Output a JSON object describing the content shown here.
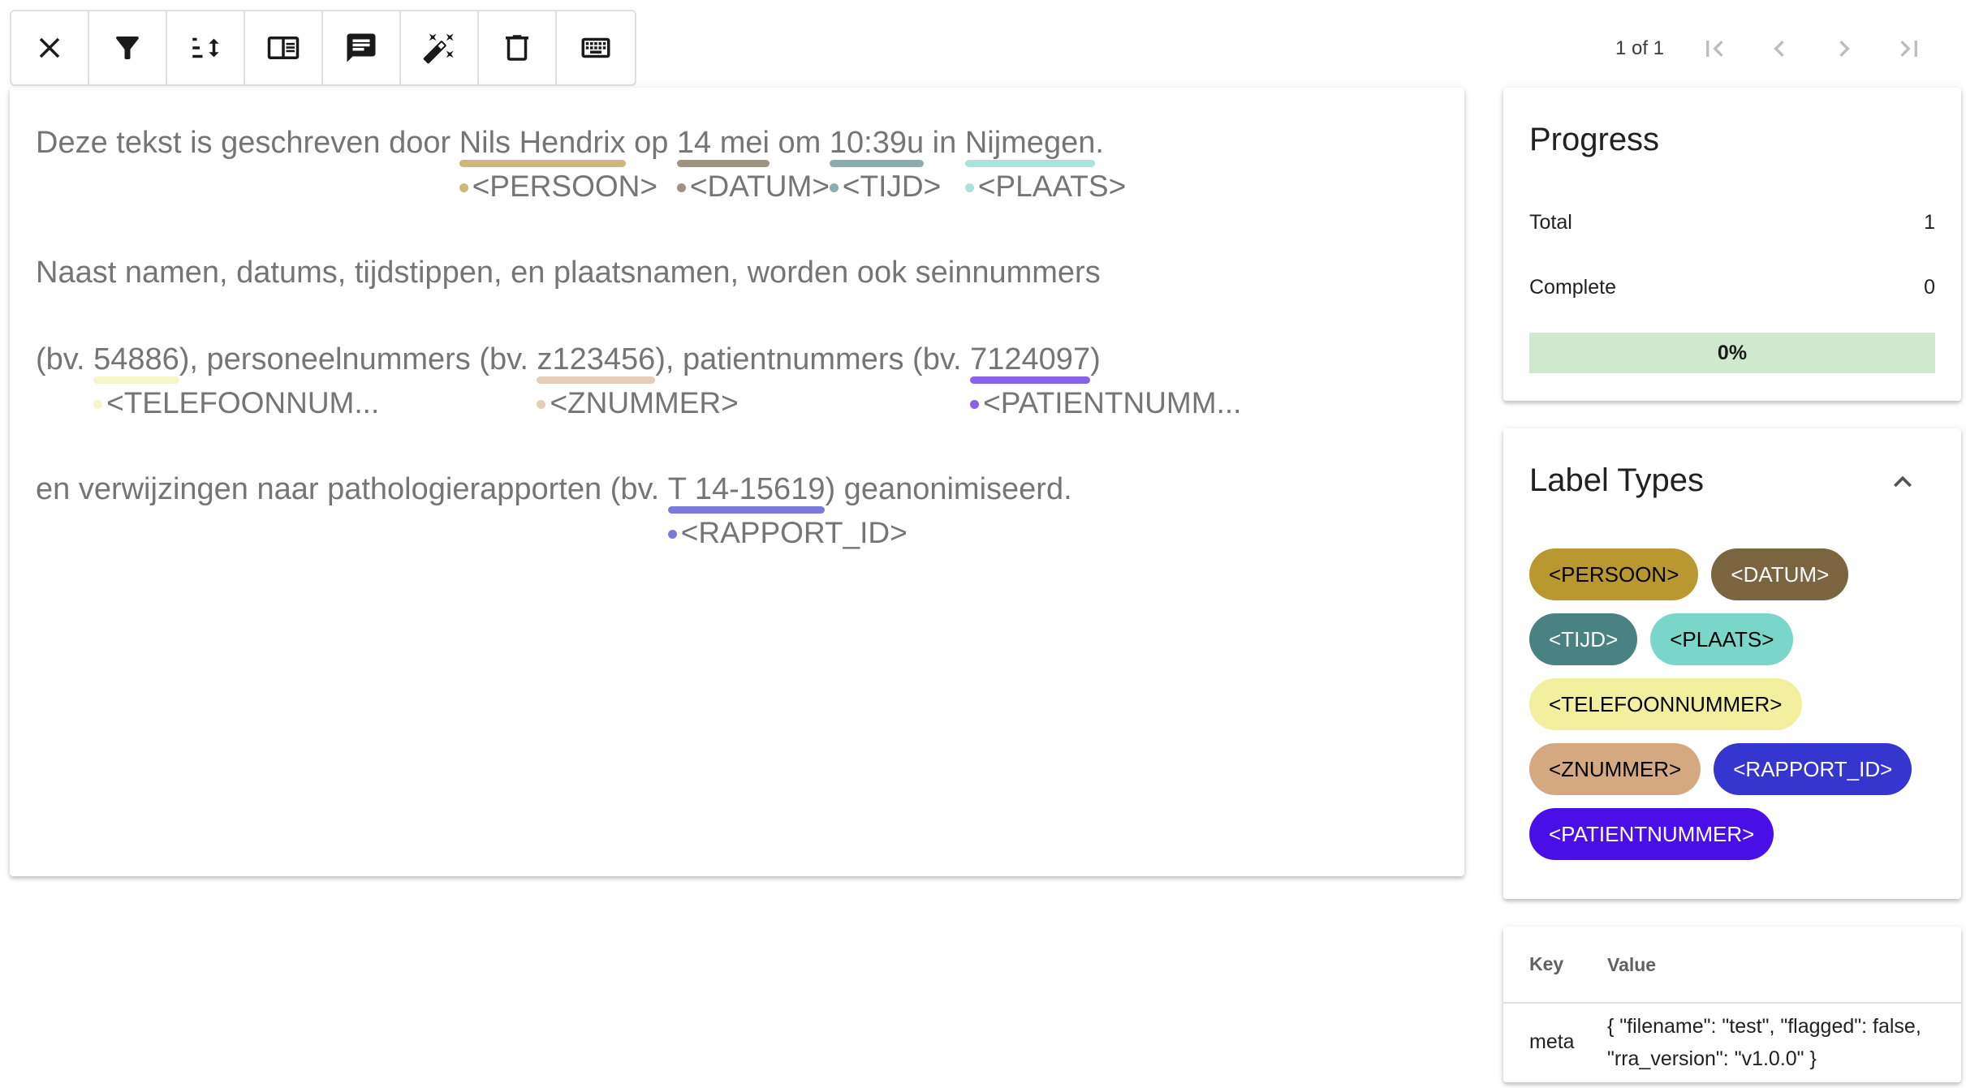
{
  "toolbar": {
    "buttons": [
      {
        "icon": "close-icon"
      },
      {
        "icon": "filter-icon"
      },
      {
        "icon": "sort-icon"
      },
      {
        "icon": "sidebar-toggle-icon"
      },
      {
        "icon": "comment-icon"
      },
      {
        "icon": "magic-wand-icon"
      },
      {
        "icon": "delete-icon"
      },
      {
        "icon": "keyboard-icon"
      }
    ]
  },
  "pager": {
    "text": "1 of 1",
    "buttons": [
      "first-page-icon",
      "previous-page-icon",
      "next-page-icon",
      "last-page-icon"
    ]
  },
  "document": {
    "line1": {
      "t0": "Deze tekst is geschreven door ",
      "e1": {
        "text": "Nils Hendrix",
        "label": "<PERSOON>"
      },
      "t1": " op ",
      "e2": {
        "text": "14 mei",
        "label": "<DATUM>"
      },
      "t2": " om ",
      "e3": {
        "text": "10:39u",
        "label": "<TIJD>"
      },
      "t3": " in ",
      "e4": {
        "text": "Nijmegen",
        "label": "<PLAATS>"
      },
      "t4": "."
    },
    "line2": "Naast namen, datums, tijdstippen, en plaatsnamen, worden ook seinnummers",
    "line3": {
      "t0": "(bv. ",
      "e1": {
        "text": "54886",
        "label": "<TELEFOONNUM..."
      },
      "t1": "), personeelnummers (bv. ",
      "e2": {
        "text": "z123456",
        "label": "<ZNUMMER>"
      },
      "t2": "), patientnummers (bv. ",
      "e3": {
        "text": "7124097",
        "label": "<PATIENTNUMM..."
      },
      "t3": ")"
    },
    "line4": {
      "t0": "en verwijzingen naar pathologierapporten (bv. ",
      "e1": {
        "text": "T 14-15619",
        "label": "<RAPPORT_ID>"
      },
      "t1": ") geanonimiseerd."
    }
  },
  "progress": {
    "title": "Progress",
    "total_label": "Total",
    "total_value": "1",
    "complete_label": "Complete",
    "complete_value": "0",
    "percent_text": "0%",
    "percent": 0
  },
  "label_types": {
    "title": "Label Types",
    "chips": [
      {
        "label": "<PERSOON>",
        "bg": "#b8982f",
        "fg": "#000000"
      },
      {
        "label": "<DATUM>",
        "bg": "#7a6540",
        "fg": "#ffffff"
      },
      {
        "label": "<TIJD>",
        "bg": "#4a8181",
        "fg": "#ffffff"
      },
      {
        "label": "<PLAATS>",
        "bg": "#7ad6c9",
        "fg": "#000000"
      },
      {
        "label": "<TELEFOONNUMMER>",
        "bg": "#f2f09f",
        "fg": "#000000"
      },
      {
        "label": "<ZNUMMER>",
        "bg": "#d4a880",
        "fg": "#000000"
      },
      {
        "label": "<RAPPORT_ID>",
        "bg": "#3535cf",
        "fg": "#ffffff"
      },
      {
        "label": "<PATIENTNUMMER>",
        "bg": "#4a0fe6",
        "fg": "#ffffff"
      }
    ]
  },
  "meta": {
    "head_key": "Key",
    "head_value": "Value",
    "row_key": "meta",
    "row_value": "{ \"filename\": \"test\", \"flagged\": false, \"rra_version\": \"v1.0.0\" }"
  },
  "colors": {
    "persoon": "#cdb87a",
    "datum": "#9e9480",
    "tijd": "#8aadad",
    "plaats": "#a8e3dc",
    "telefoon": "#f6f5c8",
    "znummer": "#e6cdb6",
    "patient": "#8663ea",
    "rapport": "#7a7adb"
  }
}
